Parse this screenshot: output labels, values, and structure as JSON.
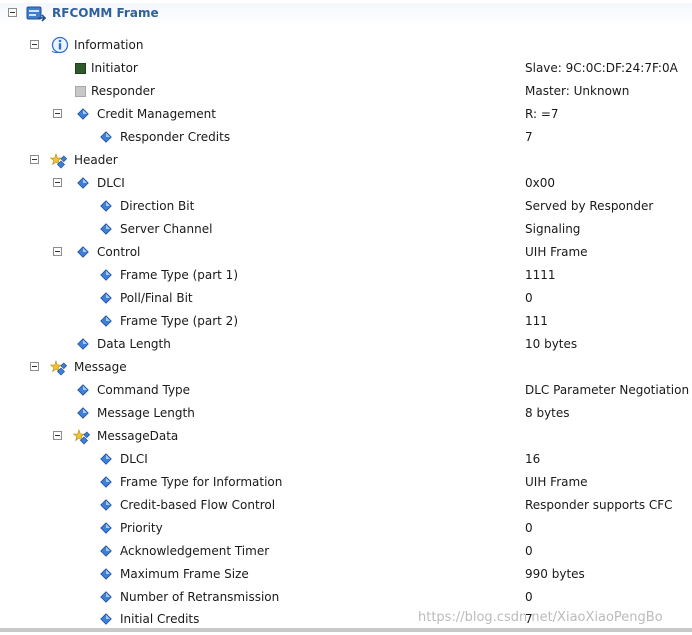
{
  "tree": {
    "root_label": "RFCOMM Frame",
    "information": {
      "label": "Information"
    },
    "initiator": {
      "label": "Initiator",
      "value": "Slave: 9C:0C:DF:24:7F:0A"
    },
    "responder": {
      "label": "Responder",
      "value": "Master: Unknown"
    },
    "credit_management": {
      "label": "Credit Management",
      "value": "R: =7"
    },
    "responder_credits": {
      "label": "Responder Credits",
      "value": "7"
    },
    "header": {
      "label": "Header"
    },
    "dlci": {
      "label": "DLCI",
      "value": "0x00"
    },
    "direction_bit": {
      "label": "Direction Bit",
      "value": "Served by Responder"
    },
    "server_channel": {
      "label": "Server Channel",
      "value": "Signaling"
    },
    "control": {
      "label": "Control",
      "value": "UIH Frame"
    },
    "frame_type_1": {
      "label": "Frame Type (part 1)",
      "value": "1111"
    },
    "poll_final": {
      "label": "Poll/Final Bit",
      "value": "0"
    },
    "frame_type_2": {
      "label": "Frame Type (part 2)",
      "value": "111"
    },
    "data_length": {
      "label": "Data Length",
      "value": "10 bytes"
    },
    "message": {
      "label": "Message"
    },
    "command_type": {
      "label": "Command Type",
      "value": "DLC Parameter Negotiation"
    },
    "message_length": {
      "label": "Message Length",
      "value": "8 bytes"
    },
    "message_data": {
      "label": "MessageData"
    },
    "md_dlci": {
      "label": "DLCI",
      "value": "16"
    },
    "md_frame_type": {
      "label": "Frame Type for Information",
      "value": "UIH Frame"
    },
    "md_cfc": {
      "label": "Credit-based Flow Control",
      "value": "Responder supports CFC"
    },
    "md_priority": {
      "label": "Priority",
      "value": "0"
    },
    "md_ack_timer": {
      "label": "Acknowledgement Timer",
      "value": "0"
    },
    "md_max_frame": {
      "label": "Maximum Frame Size",
      "value": "990 bytes"
    },
    "md_retrans": {
      "label": "Number of Retransmission",
      "value": "0"
    },
    "md_initial_credits": {
      "label": "Initial Credits",
      "value": "7"
    }
  },
  "watermark": "https://blog.csdn.net/XiaoXiaoPengBo",
  "colors": {
    "root_text": "#2f5f9e",
    "diamond": "#2e6fcf",
    "initiator_square": "#2e5a2b",
    "responder_square": "#c8c8c8"
  }
}
